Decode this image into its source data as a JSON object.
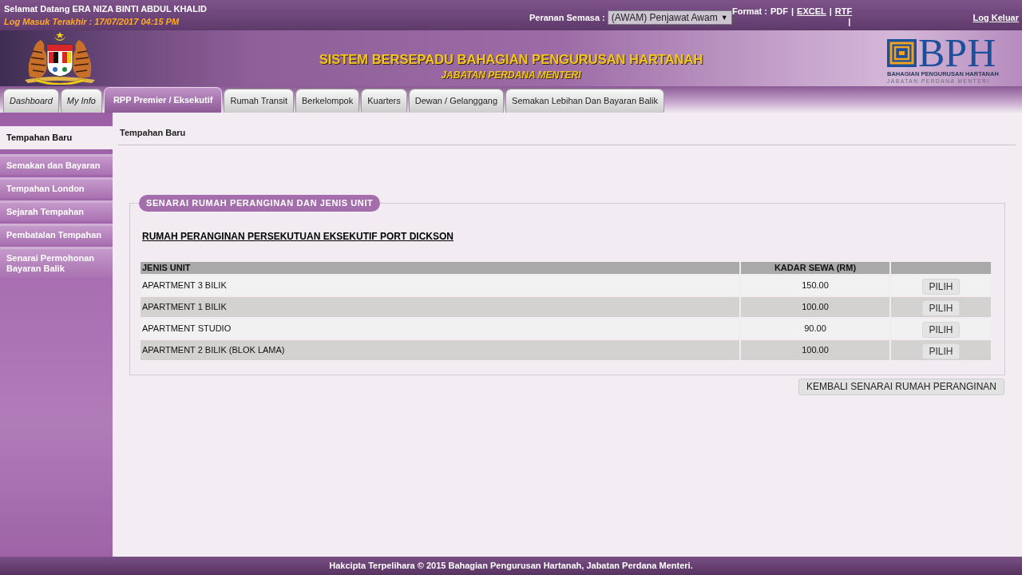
{
  "top_bar": {
    "welcome": "Selamat Datang ERA NIZA BINTI ABDUL KHALID",
    "last_login": "Log Masuk Terakhir : 17/07/2017 04:15 PM",
    "role": {
      "label": "Peranan Semasa :",
      "value": "(AWAM) Penjawat Awam",
      "arrow": "▼"
    },
    "format": {
      "label": "Format :",
      "items": [
        {
          "text": "PDF",
          "kind": "plain"
        },
        {
          "text": "|",
          "kind": "separator"
        },
        {
          "text": "EXCEL",
          "kind": "link"
        },
        {
          "text": "|",
          "kind": "separator"
        },
        {
          "text": "RTF",
          "kind": "link"
        }
      ],
      "trailing": "|"
    },
    "logout": "Log Keluar"
  },
  "banner": {
    "title": "SISTEM BERSEPADU BAHAGIAN PENGURUSAN HARTANAH",
    "subtitle": "JABATAN PERDANA MENTERI",
    "logo": {
      "text": "BPH",
      "line_1": "BAHAGIAN PENGURUSAN HARTANAH",
      "line_2": "JABATAN PERDANA MENTERI"
    }
  },
  "tabs": [
    {
      "label": "Dashboard",
      "selected": false,
      "italic": true
    },
    {
      "label": "My Info",
      "selected": false,
      "italic": true
    },
    {
      "label": "RPP Premier / Eksekutif",
      "selected": true,
      "italic": false
    },
    {
      "label": "Rumah Transit",
      "selected": false,
      "italic": false
    },
    {
      "label": "Berkelompok",
      "selected": false,
      "italic": false
    },
    {
      "label": "Kuarters",
      "selected": false,
      "italic": false
    },
    {
      "label": "Dewan / Gelanggang",
      "selected": false,
      "italic": false
    },
    {
      "label": "Semakan Lebihan Dan Bayaran Balik",
      "selected": false,
      "italic": false
    }
  ],
  "sidebar": {
    "items": [
      {
        "label": "Tempahan Baru",
        "selected": true
      },
      {
        "label": "Semakan dan Bayaran",
        "selected": false
      },
      {
        "label": "Tempahan London",
        "selected": false
      },
      {
        "label": "Sejarah Tempahan",
        "selected": false
      },
      {
        "label": "Pembatalan Tempahan",
        "selected": false
      },
      {
        "label": "Senarai Permohonan Bayaran Balik",
        "selected": false
      }
    ]
  },
  "content": {
    "heading": "Tempahan Baru",
    "panel": {
      "legend": "SENARAI RUMAH PERANGINAN DAN JENIS UNIT",
      "title": "RUMAH PERANGINAN PERSEKUTUAN EKSEKUTIF PORT DICKSON",
      "table": {
        "columns": [
          "JENIS UNIT",
          "KADAR SEWA (RM)"
        ],
        "rows": [
          {
            "unit": "APARTMENT 3 BILIK",
            "rate": "150.00",
            "action": "PILIH"
          },
          {
            "unit": "APARTMENT 1 BILIK",
            "rate": "100.00",
            "action": "PILIH"
          },
          {
            "unit": "APARTMENT STUDIO",
            "rate": "90.00",
            "action": "PILIH"
          },
          {
            "unit": "APARTMENT 2 BILIK (BLOK LAMA)",
            "rate": "100.00",
            "action": "PILIH"
          }
        ]
      }
    },
    "back_button": "KEMBALI SENARAI RUMAH PERANGINAN"
  },
  "footer": "Hakcipta Terpelihara © 2015 Bahagian Pengurusan Hartanah, Jabatan Perdana Menteri."
}
